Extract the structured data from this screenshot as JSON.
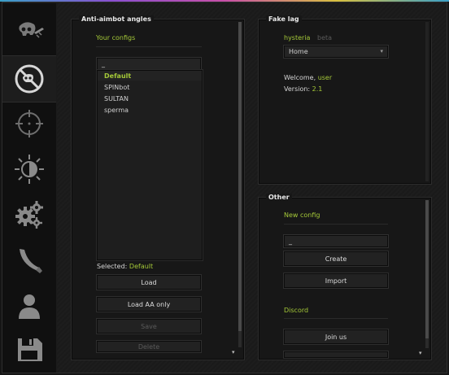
{
  "sidebar": {
    "tabs": [
      {
        "icon": "skull-knife-icon"
      },
      {
        "icon": "no-aim-icon",
        "active": true
      },
      {
        "icon": "crosshair-icon"
      },
      {
        "icon": "brightness-icon"
      },
      {
        "icon": "gears-icon"
      },
      {
        "icon": "knife-icon"
      },
      {
        "icon": "person-icon"
      },
      {
        "icon": "floppy-disk-icon"
      }
    ]
  },
  "anti_aim": {
    "title": "Anti-aimbot angles",
    "your_configs": "Your configs",
    "search_value": "_",
    "configs": [
      "Default",
      "SPINbot",
      "SULTAN",
      "sperma"
    ],
    "selected_label": "Selected:",
    "selected_value": "Default",
    "buttons": {
      "load": "Load",
      "load_aa": "Load AA only",
      "save": "Save",
      "delete": "Delete"
    }
  },
  "fake_lag": {
    "title": "Fake lag",
    "brand": "hysteria",
    "brand_suffix": "beta",
    "dropdown_value": "Home",
    "welcome_label": "Welcome,",
    "welcome_user": "user",
    "version_label": "Version:",
    "version_value": "2.1"
  },
  "other": {
    "title": "Other",
    "new_config": "New config",
    "new_config_value": "_",
    "create": "Create",
    "import": "Import",
    "discord": "Discord",
    "join_us": "Join us"
  },
  "colors": {
    "accent": "#a4c838",
    "background": "#151515"
  }
}
